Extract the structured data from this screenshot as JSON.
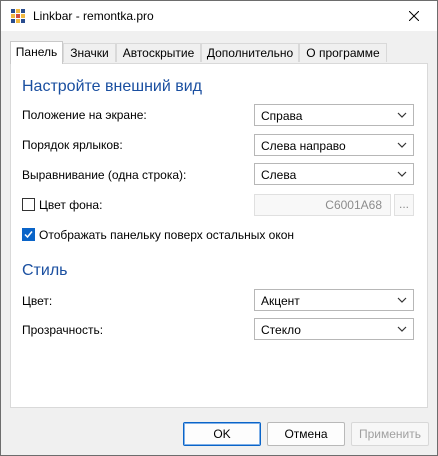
{
  "window": {
    "title": "Linkbar - remontka.pro"
  },
  "tabs": [
    {
      "label": "Панель"
    },
    {
      "label": "Значки"
    },
    {
      "label": "Автоскрытие"
    },
    {
      "label": "Дополнительно"
    },
    {
      "label": "О программе"
    }
  ],
  "appearance": {
    "title": "Настройте внешний вид",
    "position": {
      "label": "Положение на экране:",
      "value": "Справа"
    },
    "order": {
      "label": "Порядок ярлыков:",
      "value": "Слева направо"
    },
    "align": {
      "label": "Выравнивание (одна строка):",
      "value": "Слева"
    },
    "bgcolor": {
      "label": "Цвет фона:",
      "checked": false,
      "value": "C6001A68",
      "picker_label": "..."
    },
    "on_top": {
      "label": "Отображать панельку поверх остальных окон",
      "checked": true
    }
  },
  "style": {
    "title": "Стиль",
    "color": {
      "label": "Цвет:",
      "value": "Акцент"
    },
    "transparency": {
      "label": "Прозрачность:",
      "value": "Стекло"
    }
  },
  "buttons": {
    "ok": "OK",
    "cancel": "Отмена",
    "apply": "Применить"
  },
  "colors": {
    "accent": "#1a4fa0",
    "check": "#0a64c8"
  }
}
